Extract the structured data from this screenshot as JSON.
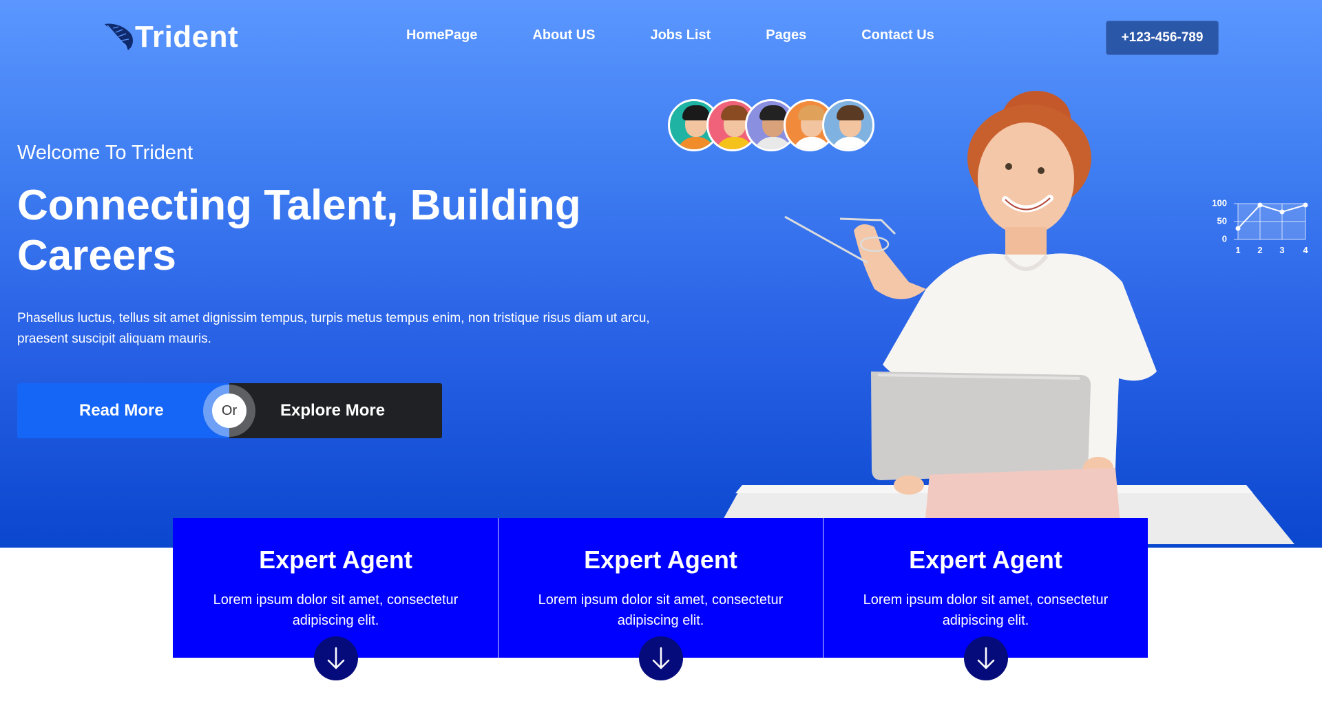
{
  "header": {
    "logo_text": "Trident",
    "nav": [
      "HomePage",
      "About US",
      "Jobs List",
      "Pages",
      "Contact Us"
    ],
    "phone": "+123-456-789"
  },
  "hero": {
    "welcome": "Welcome To Trident",
    "headline": "Connecting Talent, Building Careers",
    "description": "Phasellus luctus, tellus sit amet dignissim tempus, turpis metus tempus enim, non tristique risus diam ut arcu, praesent suscipit aliquam mauris.",
    "read_more": "Read More",
    "or": "Or",
    "explore_more": "Explore More"
  },
  "mini_chart": {
    "y_labels": [
      "100",
      "50",
      "0"
    ],
    "x_labels": [
      "1",
      "2",
      "3",
      "4"
    ]
  },
  "cards": [
    {
      "title": "Expert Agent",
      "text": "Lorem ipsum dolor sit amet, consectetur adipiscing elit."
    },
    {
      "title": "Expert Agent",
      "text": "Lorem ipsum dolor sit amet, consectetur adipiscing elit."
    },
    {
      "title": "Expert Agent",
      "text": "Lorem ipsum dolor sit amet, consectetur adipiscing elit."
    }
  ],
  "colors": {
    "hero_top": "#5b97ff",
    "hero_bottom": "#0a47cf",
    "card_bg": "#0000ff",
    "read_btn": "#1566f7",
    "explore_btn": "#1f2124",
    "arrow_circle": "#050b7a"
  },
  "icons": {
    "logo": "feather-icon",
    "card_arrow": "arrow-down-icon"
  }
}
